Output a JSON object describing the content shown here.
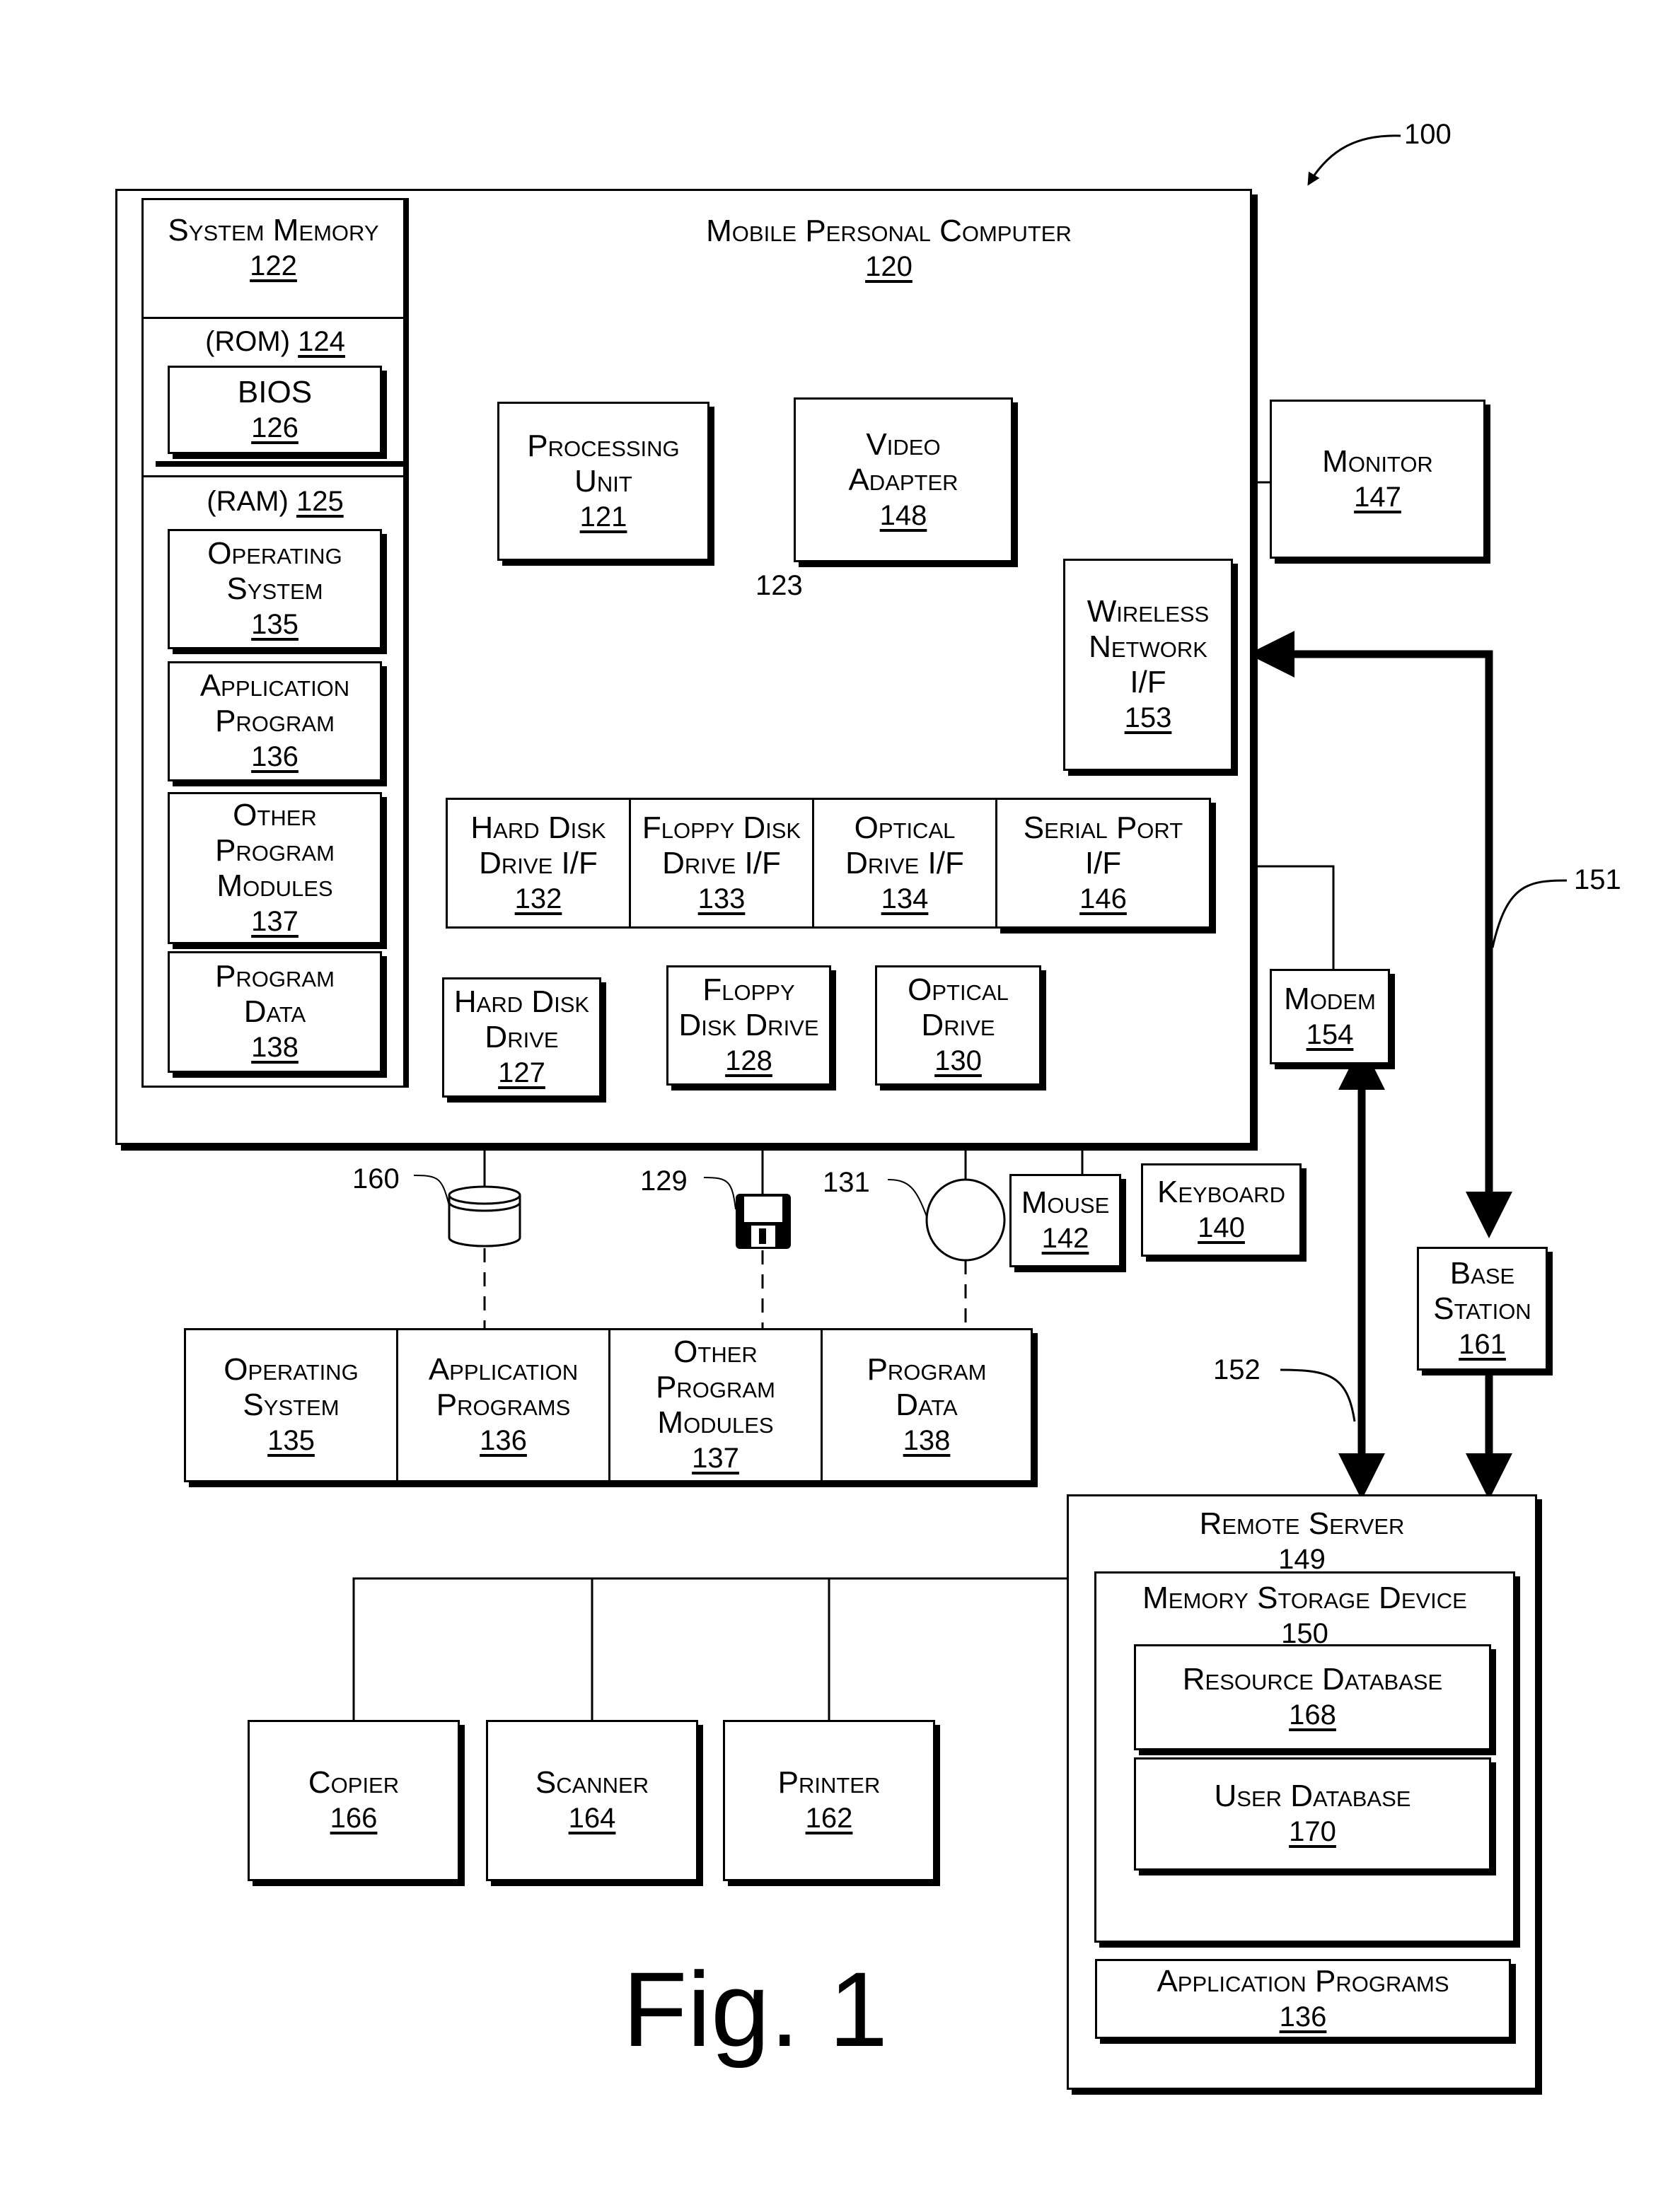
{
  "figure_number_label": "100",
  "figure_caption": "Fig. 1",
  "mobile_pc": {
    "label": "Mobile Personal Computer",
    "num": "120"
  },
  "system_memory": {
    "label": "System Memory",
    "num": "122"
  },
  "rom": {
    "label": "(ROM)",
    "num": "124"
  },
  "bios": {
    "label": "BIOS",
    "num": "126"
  },
  "ram": {
    "label": "(RAM)",
    "num": "125"
  },
  "ram_items": [
    {
      "label": "Operating\nSystem",
      "num": "135"
    },
    {
      "label": "Application\nProgram",
      "num": "136"
    },
    {
      "label": "Other\nProgram\nModules",
      "num": "137"
    },
    {
      "label": "Program\nData",
      "num": "138"
    }
  ],
  "processing_unit": {
    "label": "Processing\nUnit",
    "num": "121"
  },
  "video_adapter": {
    "label": "Video\nAdapter",
    "num": "148"
  },
  "monitor": {
    "label": "Monitor",
    "num": "147"
  },
  "wireless_if": {
    "label": "Wireless\nNetwork\nI/F",
    "num": "153"
  },
  "bus_ref": "123",
  "interfaces": [
    {
      "label": "Hard Disk\nDrive I/F",
      "num": "132"
    },
    {
      "label": "Floppy Disk\nDrive I/F",
      "num": "133"
    },
    {
      "label": "Optical\nDrive I/F",
      "num": "134"
    },
    {
      "label": "Serial Port\nI/F",
      "num": "146"
    }
  ],
  "drives": [
    {
      "label": "Hard Disk\nDrive",
      "num": "127"
    },
    {
      "label": "Floppy\nDisk Drive",
      "num": "128"
    },
    {
      "label": "Optical\nDrive",
      "num": "130"
    }
  ],
  "modem": {
    "label": "Modem",
    "num": "154"
  },
  "mouse": {
    "label": "Mouse",
    "num": "142"
  },
  "keyboard": {
    "label": "Keyboard",
    "num": "140"
  },
  "media_refs": {
    "hard_disk": "160",
    "floppy": "129",
    "optical": "131"
  },
  "media_icons": [
    "hard-disk-cylinder-icon",
    "floppy-disk-icon",
    "optical-disc-icon"
  ],
  "storage_items": [
    {
      "label": "Operating\nSystem",
      "num": "135"
    },
    {
      "label": "Application\nPrograms",
      "num": "136"
    },
    {
      "label": "Other\nProgram\nModules",
      "num": "137"
    },
    {
      "label": "Program\nData",
      "num": "138"
    }
  ],
  "link_refs": {
    "wireless_link": "151",
    "modem_link": "152"
  },
  "base_station": {
    "label": "Base\nStation",
    "num": "161"
  },
  "remote_server": {
    "label": "Remote Server",
    "num": "149"
  },
  "memory_storage": {
    "label": "Memory Storage Device",
    "num": "150"
  },
  "resource_db": {
    "label": "Resource Database",
    "num": "168"
  },
  "user_db": {
    "label": "User Database",
    "num": "170"
  },
  "server_apps": {
    "label": "Application Programs",
    "num": "136"
  },
  "peripherals": [
    {
      "label": "Copier",
      "num": "166"
    },
    {
      "label": "Scanner",
      "num": "164"
    },
    {
      "label": "Printer",
      "num": "162"
    }
  ]
}
